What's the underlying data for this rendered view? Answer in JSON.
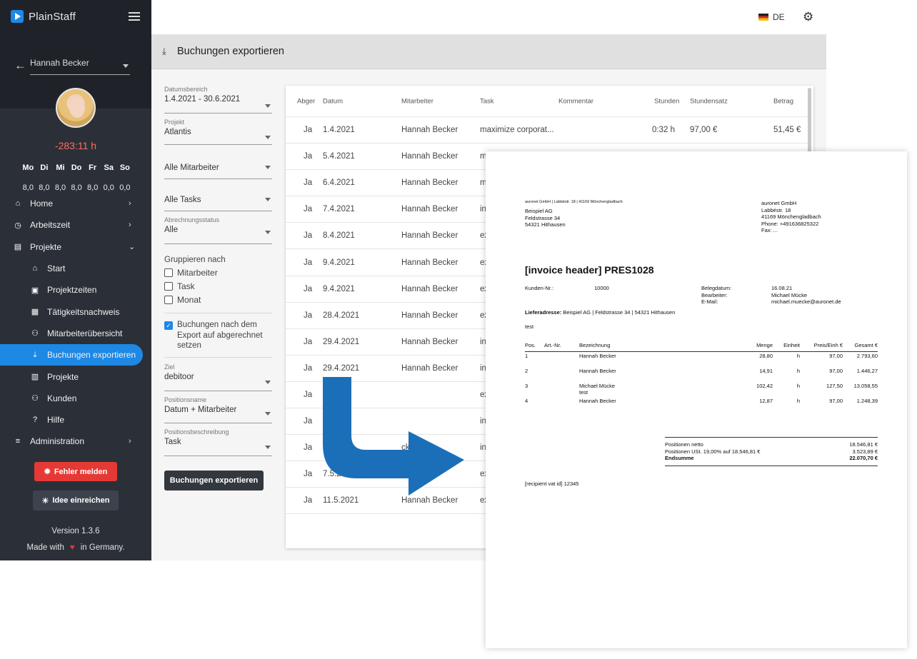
{
  "app": {
    "name": "PlainStaff"
  },
  "user": {
    "name": "Hannah Becker",
    "hours": "-283:11 h"
  },
  "week": {
    "days": [
      "Mo",
      "Di",
      "Mi",
      "Do",
      "Fr",
      "Sa",
      "So"
    ],
    "values": [
      "8,0",
      "8,0",
      "8,0",
      "8,0",
      "8,0",
      "0,0",
      "0,0"
    ]
  },
  "nav": [
    {
      "label": "Home",
      "icon": "home-icon",
      "glyph": "⌂",
      "sub": false,
      "chevron": "›"
    },
    {
      "label": "Arbeitszeit",
      "icon": "clock-icon",
      "glyph": "◷",
      "sub": false,
      "chevron": "›"
    },
    {
      "label": "Projekte",
      "icon": "clipboard-icon",
      "glyph": "▤",
      "sub": false,
      "chevron": "⌄"
    },
    {
      "label": "Start",
      "icon": "home-icon",
      "glyph": "⌂",
      "sub": true
    },
    {
      "label": "Projektzeiten",
      "icon": "calendar-add-icon",
      "glyph": "▣",
      "sub": true
    },
    {
      "label": "Tätigkeitsnachweis",
      "icon": "table-icon",
      "glyph": "▦",
      "sub": true
    },
    {
      "label": "Mitarbeiterübersicht",
      "icon": "people-icon",
      "glyph": "⚇",
      "sub": true
    },
    {
      "label": "Buchungen exportieren",
      "icon": "download-icon",
      "glyph": "⤓",
      "sub": true,
      "active": true
    },
    {
      "label": "Projekte",
      "icon": "briefcase-icon",
      "glyph": "▥",
      "sub": true
    },
    {
      "label": "Kunden",
      "icon": "people-icon",
      "glyph": "⚇",
      "sub": true
    },
    {
      "label": "Hilfe",
      "icon": "help-icon",
      "glyph": "?",
      "sub": true
    },
    {
      "label": "Administration",
      "icon": "sliders-icon",
      "glyph": "≡",
      "sub": false,
      "chevron": "›"
    }
  ],
  "buttons": {
    "report_error": "Fehler melden",
    "submit_idea": "Idee einreichen",
    "export": "Buchungen exportieren"
  },
  "footer": {
    "version": "Version 1.3.6",
    "made_prefix": "Made with",
    "made_suffix": "in Germany."
  },
  "topbar": {
    "language": "DE"
  },
  "page": {
    "title": "Buchungen exportieren"
  },
  "filters": {
    "date_range": {
      "label": "Datumsbereich",
      "value": "1.4.2021 - 30.6.2021"
    },
    "project": {
      "label": "Projekt",
      "value": "Atlantis"
    },
    "employees": {
      "value": "Alle Mitarbeiter"
    },
    "tasks": {
      "value": "Alle Tasks"
    },
    "billing_status": {
      "label": "Abrechnungsstatus",
      "value": "Alle"
    },
    "group_by": {
      "label": "Gruppieren nach",
      "options": [
        "Mitarbeiter",
        "Task",
        "Monat"
      ]
    },
    "mark_billed": {
      "label": "Buchungen nach dem Export auf abgerechnet setzen",
      "checked": true
    },
    "target": {
      "label": "Ziel",
      "value": "debitoor"
    },
    "position_name": {
      "label": "Positionsname",
      "value": "Datum + Mitarbeiter"
    },
    "position_desc": {
      "label": "Positionsbeschreibung",
      "value": "Task"
    }
  },
  "table": {
    "headers": [
      "Abger",
      "Datum",
      "Mitarbeiter",
      "Task",
      "Kommentar",
      "Stunden",
      "Stundensatz",
      "Betrag"
    ],
    "rows": [
      [
        "Ja",
        "1.4.2021",
        "Hannah Becker",
        "maximize corporat...",
        "",
        "0:32 h",
        "97,00 €",
        "51,45 €"
      ],
      [
        "Ja",
        "5.4.2021",
        "Hannah Becker",
        "m",
        "",
        "",
        "",
        ""
      ],
      [
        "Ja",
        "6.4.2021",
        "Hannah Becker",
        "m",
        "",
        "",
        "",
        ""
      ],
      [
        "Ja",
        "7.4.2021",
        "Hannah Becker",
        "in",
        "",
        "",
        "",
        ""
      ],
      [
        "Ja",
        "8.4.2021",
        "Hannah Becker",
        "ex",
        "",
        "",
        "",
        ""
      ],
      [
        "Ja",
        "9.4.2021",
        "Hannah Becker",
        "ex",
        "",
        "",
        "",
        ""
      ],
      [
        "Ja",
        "9.4.2021",
        "Hannah Becker",
        "ex",
        "",
        "",
        "",
        ""
      ],
      [
        "Ja",
        "28.4.2021",
        "Hannah Becker",
        "ex",
        "",
        "",
        "",
        ""
      ],
      [
        "Ja",
        "29.4.2021",
        "Hannah Becker",
        "in",
        "",
        "",
        "",
        ""
      ],
      [
        "Ja",
        "29.4.2021",
        "Hannah Becker",
        "in",
        "",
        "",
        "",
        ""
      ],
      [
        "Ja",
        "1",
        "",
        "ex",
        "",
        "",
        "",
        ""
      ],
      [
        "Ja",
        "",
        "",
        "in",
        "",
        "",
        "",
        ""
      ],
      [
        "Ja",
        "5",
        "cker",
        "in",
        "",
        "",
        "",
        ""
      ],
      [
        "Ja",
        "7.5.20",
        "",
        "ex",
        "",
        "",
        "",
        ""
      ],
      [
        "Ja",
        "11.5.2021",
        "Hannah Becker",
        "ex",
        "",
        "",
        "",
        ""
      ]
    ]
  },
  "invoice": {
    "sender_line": "auronet GmbH | Labbéstr. 18 | 41169 Mönchengladbach",
    "recipient": [
      "Beispiel AG",
      "Feldstrasse 34",
      "54321 Hithausen"
    ],
    "company": [
      "auronet GmbH",
      "Labbéstr. 18",
      "41169 Mönchengladbach",
      "Phone: +491636825322",
      "Fax: ..."
    ],
    "title": "[invoice header] PRES1028",
    "customer_no_label": "Kunden-Nr.:",
    "customer_no": "10000",
    "meta_labels": [
      "Belegdatum:",
      "Bearbeiter:",
      "E-Mail:"
    ],
    "meta_values": [
      "16.08.21",
      "Michael Mücke",
      "michael.muecke@auronet.de"
    ],
    "delivery_label": "Lieferadresse:",
    "delivery_value": "Beispiel AG | Feldstrasse 34 | 54321 Hithausen",
    "note": "test",
    "columns": [
      "Pos.",
      "Art.-Nr.",
      "Bezeichnung",
      "Menge",
      "Einheit",
      "Preis/Einh €",
      "Gesamt €"
    ],
    "items": [
      {
        "pos": "1",
        "desc": "Hannah Becker",
        "sub": "",
        "qty": "28,80",
        "unit": "h",
        "price": "97,00",
        "total": "2.793,60"
      },
      {
        "pos": "2",
        "desc": "Hannah Becker",
        "sub": "",
        "qty": "14,91",
        "unit": "h",
        "price": "97,00",
        "total": "1.446,27"
      },
      {
        "pos": "3",
        "desc": "Michael Mücke",
        "sub": "test",
        "qty": "102,42",
        "unit": "h",
        "price": "127,50",
        "total": "13.058,55"
      },
      {
        "pos": "4",
        "desc": "Hannah Becker",
        "sub": "",
        "qty": "12,87",
        "unit": "h",
        "price": "97,00",
        "total": "1.248,39"
      }
    ],
    "totals": [
      {
        "label": "Positionen netto",
        "value": "18.546,81 €"
      },
      {
        "label": "Positionen USt. 19,00% auf 18.546,81 €",
        "value": "3.523,89 €"
      },
      {
        "label": "Endsumme",
        "value": "22.070,70 €"
      }
    ],
    "vat_line": "[recipient vat id] 12345"
  },
  "colors": {
    "accent": "#1e88e5",
    "sidebar": "#2b3038",
    "danger": "#e53935",
    "arrow": "#1b6fb8"
  }
}
